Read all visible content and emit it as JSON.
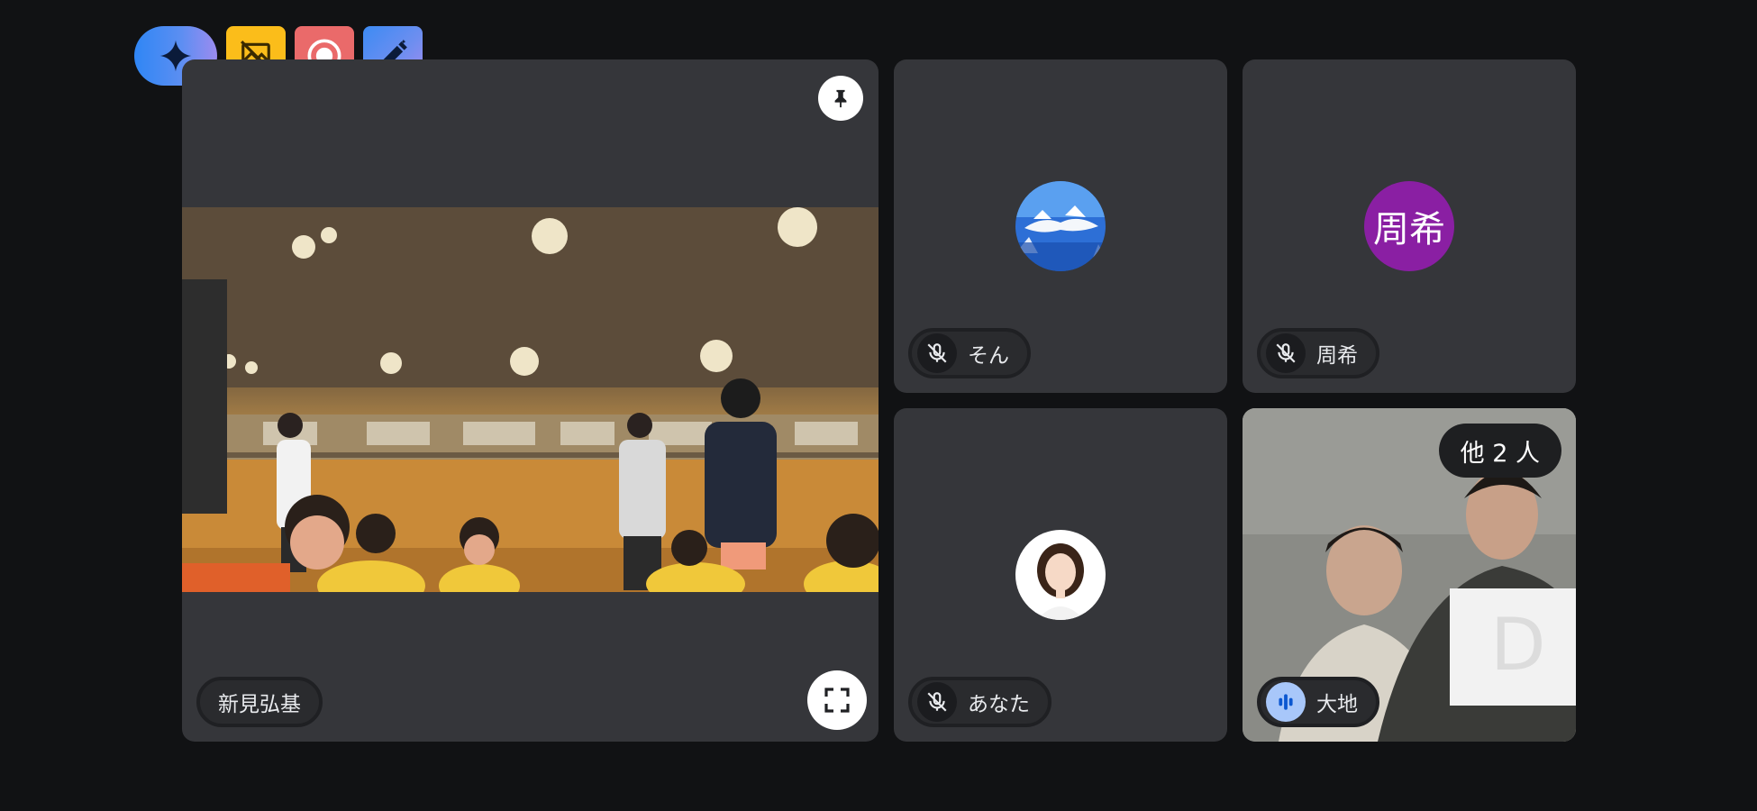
{
  "toolbar": {
    "items": [
      {
        "icon": "gemini-sparkle-icon",
        "color": "#2f86f5"
      },
      {
        "icon": "background-off-icon",
        "color": "#fbbd1a"
      },
      {
        "icon": "record-icon",
        "color": "#ea6a6a"
      },
      {
        "icon": "edit-pen-icon",
        "color": "#3c8bf4"
      }
    ]
  },
  "tiles": {
    "main": {
      "name": "新見弘基",
      "pin_icon": "pin-icon",
      "fullscreen_icon": "fullscreen-icon"
    },
    "son": {
      "name": "そん",
      "mic": "muted"
    },
    "shuki": {
      "name": "周希",
      "initial": "周希",
      "avatar_color": "#8a1fa3",
      "mic": "muted"
    },
    "anata": {
      "name": "あなた",
      "mic": "muted"
    },
    "daichi": {
      "name": "大地",
      "mic": "speaking",
      "others_label": "他 2 人"
    }
  }
}
